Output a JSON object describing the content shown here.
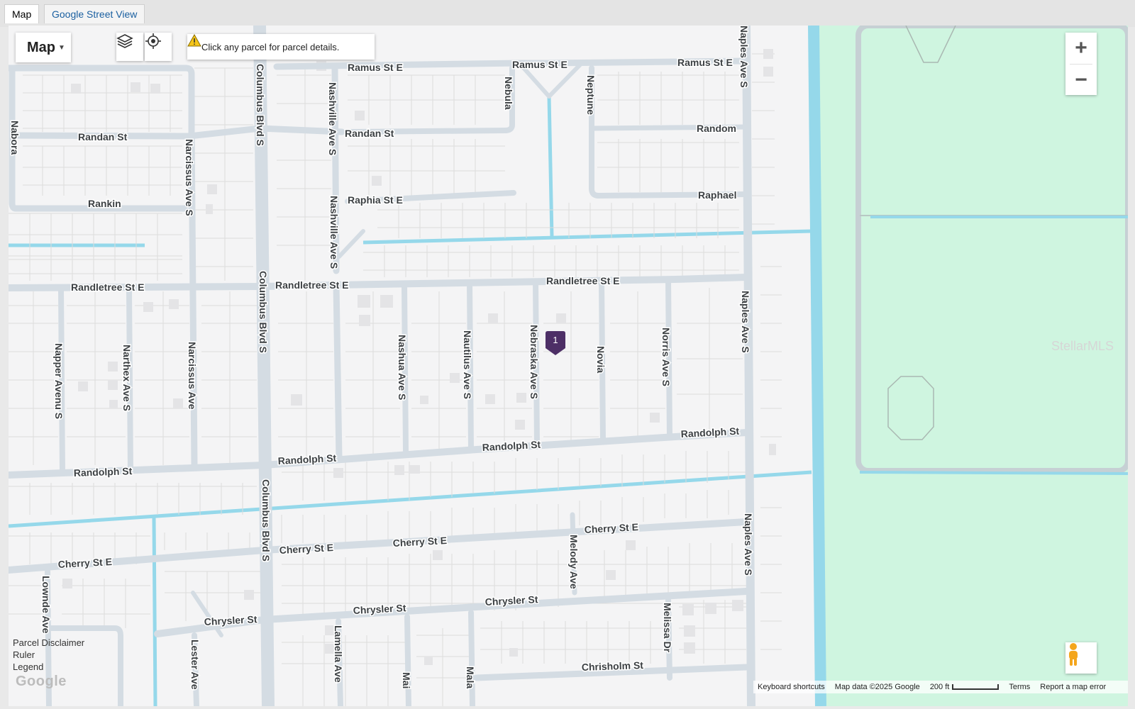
{
  "tabs": [
    {
      "label": "Map",
      "active": true
    },
    {
      "label": "Google Street View",
      "active": false
    }
  ],
  "controls": {
    "map_type_label": "Map",
    "layers_icon": "layers-icon",
    "locate_icon": "crosshair-icon",
    "notice_text": "Click any parcel for parcel details.",
    "notice_icon": "warning-icon",
    "zoom_in": "+",
    "zoom_out": "−",
    "pegman_icon": "pegman-icon"
  },
  "marker": {
    "label": "1",
    "color": "#4d2f66"
  },
  "left_links": [
    "Parcel Disclaimer",
    "Ruler",
    "Legend"
  ],
  "logo": "Google",
  "watermark": "StellarMLS",
  "footer": {
    "shortcuts": "Keyboard shortcuts",
    "map_data": "Map data ©2025 Google",
    "scale": "200 ft",
    "terms": "Terms",
    "report": "Report a map error"
  },
  "colors": {
    "road": "#d4dce3",
    "water": "#95d8ea",
    "park": "#cff5e0",
    "background": "#f4f4f5"
  },
  "streets": {
    "ramus_st_e_1": "Ramus St E",
    "ramus_st_e_2": "Ramus St E",
    "ramus_st_e_3": "Ramus St E",
    "nebula": "Nebula",
    "neptune": "Neptune",
    "randan_st_1": "Randan St",
    "randan_st_2": "Randan St",
    "random": "Random",
    "nabora": "Nabora",
    "rankin": "Rankin",
    "raphia_st_e": "Raphia St E",
    "raphael": "Raphael",
    "nashville_ave_s_1": "Nashville Ave S",
    "nashville_ave_s_2": "Nashville Ave S",
    "columbus_blvd_s_1": "Columbus Blvd S",
    "columbus_blvd_s_2": "Columbus Blvd S",
    "columbus_blvd_s_3": "Columbus Blvd S",
    "narcissus_ave_s_1": "Narcissus Ave S",
    "narcissus_ave_s_2": "Narcissus Ave",
    "randletree_st_e_1": "Randletree St E",
    "randletree_st_e_2": "Randletree St E",
    "randletree_st_e_3": "Randletree St E",
    "napper_avenu_s": "Napper Avenu S",
    "narthex_ave_s": "Narthex Ave S",
    "nashua_ave_s": "Nashua Ave S",
    "nautilus_ave_s": "Nautilus Ave S",
    "nebraska_ave_s": "Nebraska Ave S",
    "novia": "Novia",
    "norris_ave_s": "Norris Ave S",
    "naples_ave_s_1": "Naples Ave S",
    "naples_ave_s_2": "Naples Ave S",
    "naples_ave_s_3": "Naples Ave S",
    "randolph_st_1": "Randolph St",
    "randolph_st_2": "Randolph St",
    "randolph_st_3": "Randolph St",
    "randolph_st_4": "Randolph St",
    "cherry_st_e_1": "Cherry St E",
    "cherry_st_e_2": "Cherry St E",
    "cherry_st_e_3": "Cherry St E",
    "cherry_st_e_4": "Cherry St E",
    "melody_ave": "Melody Ave",
    "lownde_ave": "Lownde Ave",
    "chrysler_st_1": "Chrysler St",
    "chrysler_st_2": "Chrysler St",
    "chrysler_st_3": "Chrysler St",
    "lester_ave": "Lester Ave",
    "lamella_ave": "Lamella Ave",
    "mai": "Mai",
    "mala": "Mala",
    "melissa_dr": "Melissa Dr",
    "chrisholm_st": "Chrisholm St"
  }
}
